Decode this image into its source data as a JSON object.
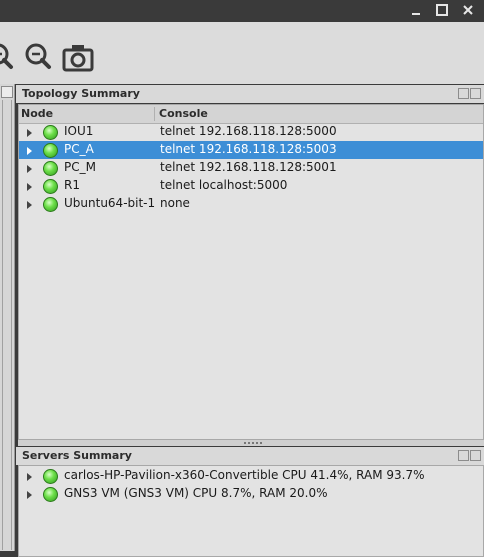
{
  "colors": {
    "selection": "#3d8ed6",
    "status_ok": "#6ee04a",
    "titlebar": "#3a3a3a"
  },
  "window": {
    "controls": [
      "minimize-icon",
      "maximize-icon",
      "close-icon"
    ]
  },
  "toolbar": {
    "icons": [
      "zoom-in-icon",
      "zoom-out-icon",
      "screenshot-icon"
    ]
  },
  "topology": {
    "title": "Topology Summary",
    "columns": {
      "node": "Node",
      "console": "Console"
    },
    "rows": [
      {
        "name": "IOU1",
        "console": "telnet 192.168.118.128:5000",
        "status": "started"
      },
      {
        "name": "PC_A",
        "console": "telnet 192.168.118.128:5003",
        "status": "started",
        "selected": true
      },
      {
        "name": "PC_M",
        "console": "telnet 192.168.118.128:5001",
        "status": "started"
      },
      {
        "name": "R1",
        "console": "telnet localhost:5000",
        "status": "started"
      },
      {
        "name": "Ubuntu64-bit-1",
        "console": "none",
        "status": "started"
      }
    ]
  },
  "servers": {
    "title": "Servers Summary",
    "rows": [
      {
        "label": "carlos-HP-Pavilion-x360-Convertible CPU 41.4%, RAM 93.7%",
        "status": "connected"
      },
      {
        "label": "GNS3 VM (GNS3 VM) CPU 8.7%, RAM 20.0%",
        "status": "connected"
      }
    ]
  }
}
